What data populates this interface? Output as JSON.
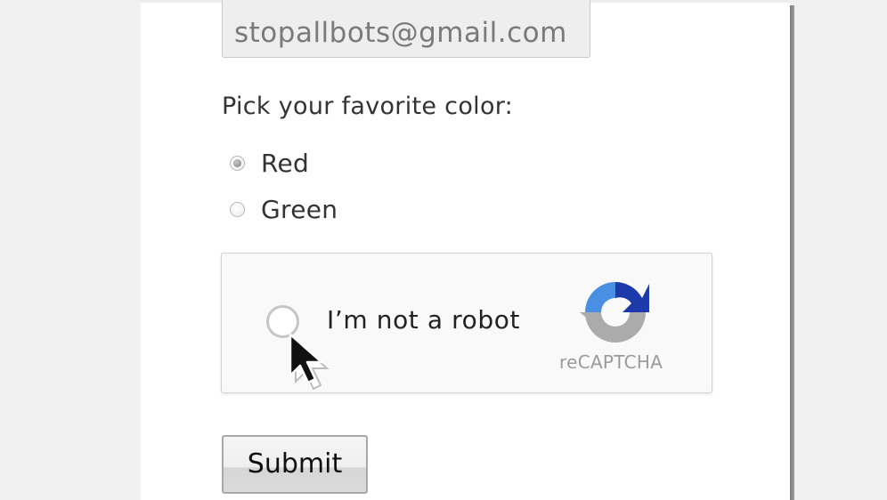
{
  "form": {
    "email_value": "stopallbots@gmail.com",
    "color_question": "Pick your favorite color:",
    "color_options": [
      {
        "label": "Red",
        "checked": true
      },
      {
        "label": "Green",
        "checked": false
      }
    ],
    "submit_label": "Submit"
  },
  "recaptcha": {
    "checkbox_label": "I’m not a robot",
    "brand": "reCAPTCHA",
    "checked": false,
    "logo_colors": {
      "blue_light": "#4a90e2",
      "blue_dark": "#1c3aa9",
      "gray": "#ababab"
    }
  },
  "cursor": {
    "icon": "arrow-cursor-icon"
  }
}
